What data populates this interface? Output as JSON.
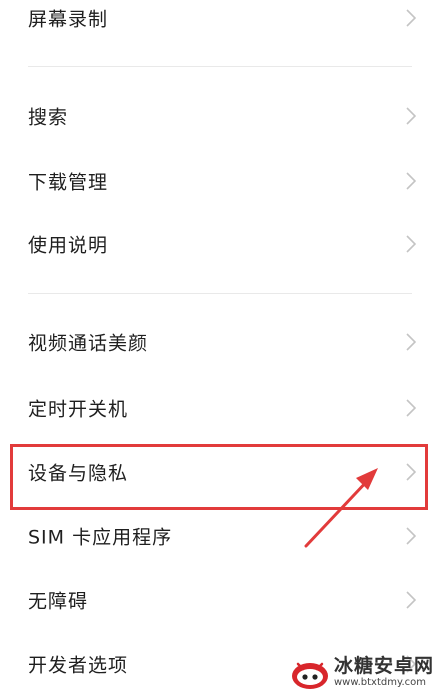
{
  "settings": {
    "items": [
      {
        "label": "屏幕录制"
      },
      {
        "label": "搜索"
      },
      {
        "label": "下载管理"
      },
      {
        "label": "使用说明"
      },
      {
        "label": "视频通话美颜"
      },
      {
        "label": "定时开关机"
      },
      {
        "label": "设备与隐私"
      },
      {
        "label": "SIM 卡应用程序"
      },
      {
        "label": "无障碍"
      },
      {
        "label": "开发者选项"
      }
    ]
  },
  "annotation": {
    "highlight_color": "#e23b3b",
    "highlighted_item": "设备与隐私"
  },
  "watermark": {
    "title": "冰糖安卓网",
    "url": "www.btxtdmy.com"
  }
}
